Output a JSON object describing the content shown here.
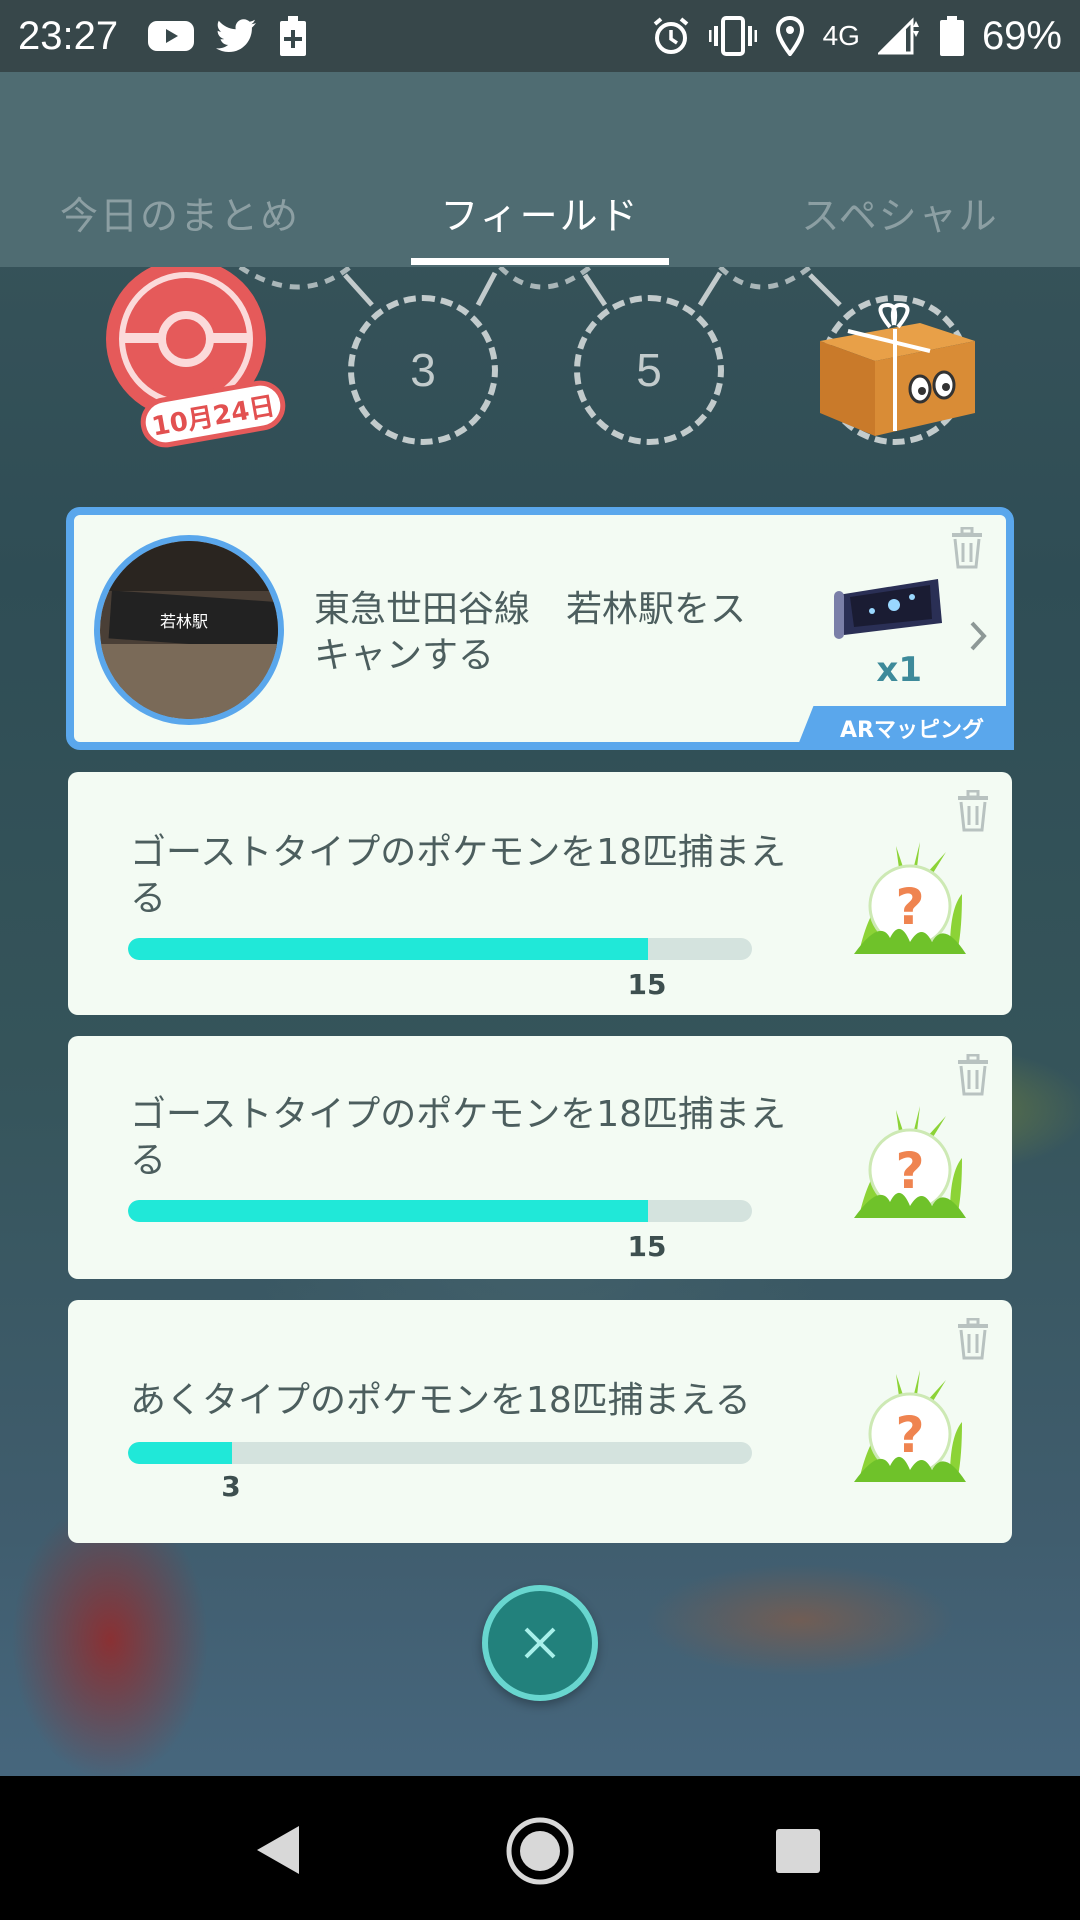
{
  "status_bar": {
    "time": "23:27",
    "network": "4G",
    "battery_percent": "69%",
    "icons_left": [
      "youtube-icon",
      "twitter-icon",
      "battery-plus-icon"
    ],
    "icons_right": [
      "alarm-icon",
      "vibrate-icon",
      "location-icon",
      "signal-icon",
      "battery-icon"
    ]
  },
  "tabs": [
    {
      "label": "今日のまとめ",
      "active": false
    },
    {
      "label": "フィールド",
      "active": true
    },
    {
      "label": "スペシャル",
      "active": false
    }
  ],
  "stamps": {
    "date_badge": "10月24日",
    "circles": [
      "3",
      "5"
    ]
  },
  "tasks": {
    "featured": {
      "title": "東急世田谷線　若林駅をスキャンする",
      "reward_count": "x1",
      "tag": "ARマッピング",
      "photo_sign_text": "若林駅"
    },
    "items": [
      {
        "title": "ゴーストタイプのポケモンを18匹捕まえる",
        "progress_value": "15",
        "progress_fraction": 0.833
      },
      {
        "title": "ゴーストタイプのポケモンを18匹捕まえる",
        "progress_value": "15",
        "progress_fraction": 0.833
      },
      {
        "title": "あくタイプのポケモンを18匹捕まえる",
        "progress_value": "3",
        "progress_fraction": 0.167
      }
    ],
    "mystery_reward_symbol": "?"
  },
  "colors": {
    "accent_blue": "#5aa7ec",
    "progress_teal": "#20e8d8",
    "card_bg": "#f3fbf3",
    "stamp_red": "#e55a5a"
  }
}
